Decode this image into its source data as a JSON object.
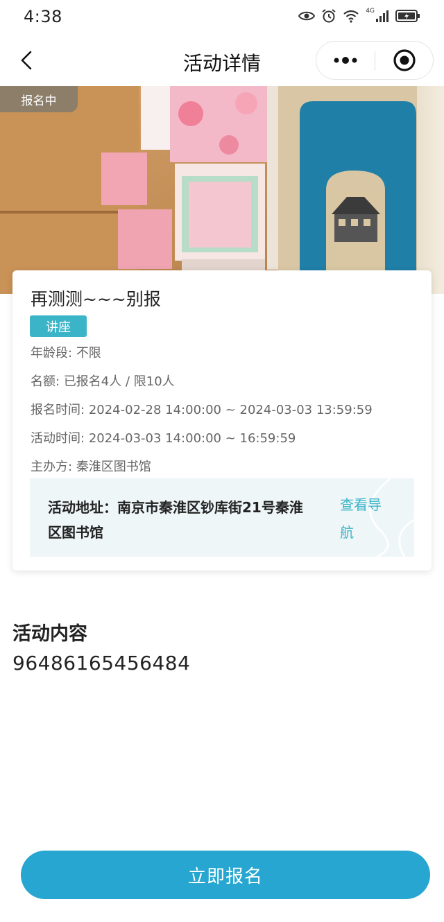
{
  "status_bar": {
    "time": "4:38",
    "network_label": "4G"
  },
  "nav": {
    "title": "活动详情"
  },
  "banner": {
    "status_badge": "报名中"
  },
  "activity": {
    "title": "再测测~~~别报",
    "tag": "讲座",
    "age_label": "年龄段:",
    "age_value": "不限",
    "quota_label": "名额:",
    "quota_value": "已报名4人 / 限10人",
    "signup_time_label": "报名时间:",
    "signup_time_value": "2024-02-28 14:00:00 ~ 2024-03-03 13:59:59",
    "activity_time_label": "活动时间:",
    "activity_time_value": "2024-03-03 14:00:00 ~ 16:59:59",
    "organizer_label": "主办方:",
    "organizer_value": "秦淮区图书馆",
    "address": "活动地址：南京市秦淮区钞库街21号秦淮区图书馆",
    "navigate_label": "查看导航"
  },
  "content": {
    "section_title": "活动内容",
    "body": "96486165456484"
  },
  "footer": {
    "signup_button": "立即报名"
  },
  "colors": {
    "accent": "#3bb4c8",
    "button": "#26a6d0",
    "address_bg": "#eef6f7"
  }
}
